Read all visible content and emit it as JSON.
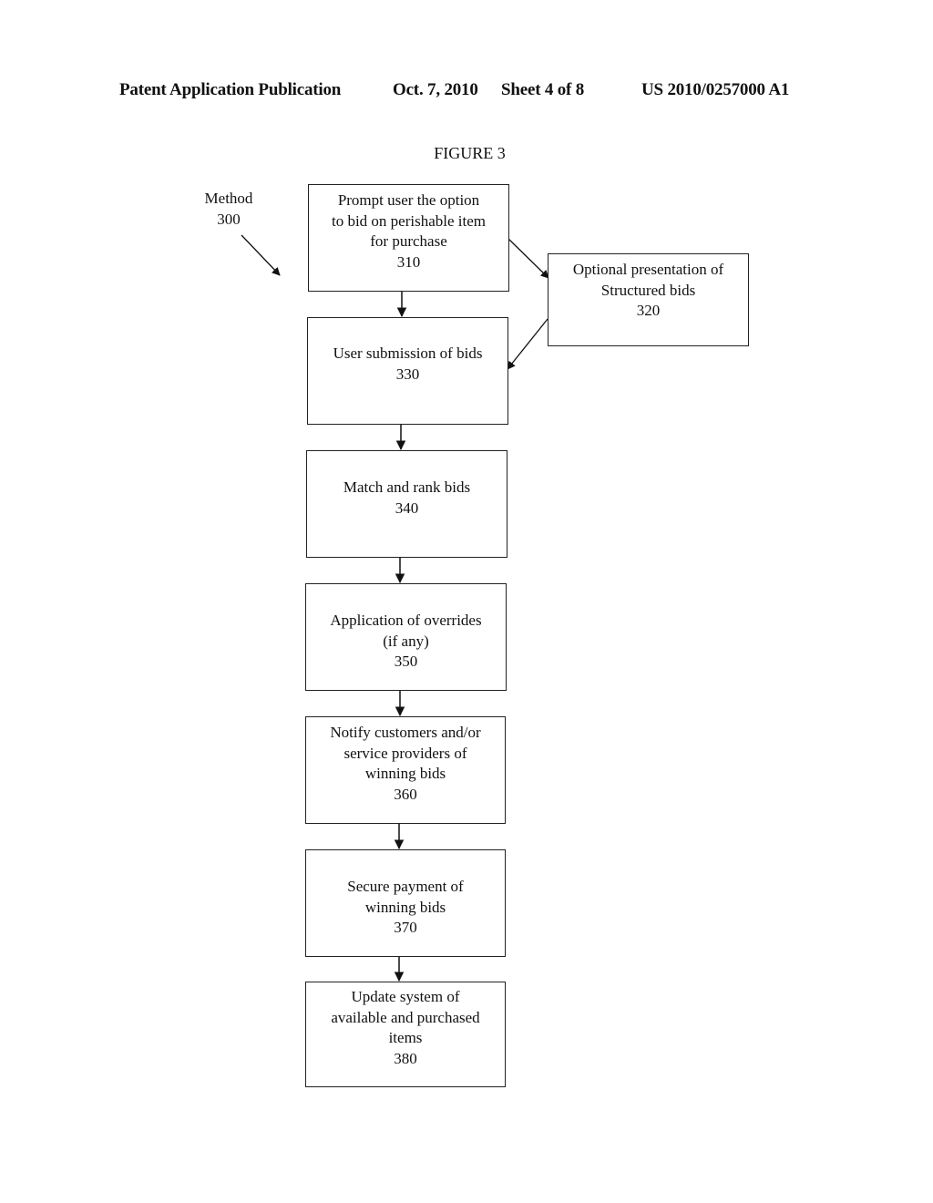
{
  "header": {
    "publication_type": "Patent Application Publication",
    "date": "Oct. 7, 2010",
    "sheet": "Sheet 4 of 8",
    "patent_number": "US 2010/0257000 A1"
  },
  "figure": {
    "title": "FIGURE 3",
    "method_label": "Method",
    "method_number": "300"
  },
  "steps": [
    {
      "id": "310",
      "lines": [
        "Prompt user the option",
        "to bid on perishable item",
        "for purchase",
        "310"
      ]
    },
    {
      "id": "320",
      "lines": [
        "Optional presentation of",
        "Structured bids",
        "320"
      ]
    },
    {
      "id": "330",
      "lines": [
        "User submission of bids",
        "330"
      ]
    },
    {
      "id": "340",
      "lines": [
        "Match and rank bids",
        "340"
      ]
    },
    {
      "id": "350",
      "lines": [
        "Application of overrides",
        "(if any)",
        "350"
      ]
    },
    {
      "id": "360",
      "lines": [
        "Notify customers and/or",
        "service providers of",
        "winning bids",
        "360"
      ]
    },
    {
      "id": "370",
      "lines": [
        "Secure payment of",
        "winning bids",
        "370"
      ]
    },
    {
      "id": "380",
      "lines": [
        "Update system of",
        "available and purchased",
        "items",
        "380"
      ]
    }
  ],
  "connections": [
    {
      "from": "310",
      "to": "330"
    },
    {
      "from": "310",
      "to": "320"
    },
    {
      "from": "320",
      "to": "330"
    },
    {
      "from": "330",
      "to": "340"
    },
    {
      "from": "340",
      "to": "350"
    },
    {
      "from": "350",
      "to": "360"
    },
    {
      "from": "360",
      "to": "370"
    },
    {
      "from": "370",
      "to": "380"
    }
  ]
}
